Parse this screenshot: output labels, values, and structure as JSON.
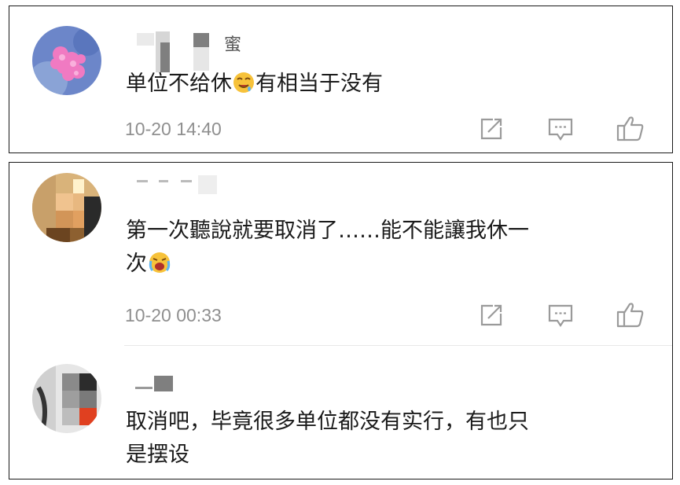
{
  "comments": [
    {
      "username_visible": "蜜",
      "text": "单位不给休",
      "text_after_emoji": "有相当于没有",
      "timestamp": "10-20 14:40",
      "emoji": "drooling-face"
    },
    {
      "text_line1": "第一次聽說就要取消了……能不能讓我休一",
      "text_line2": "次",
      "timestamp": "10-20 00:33",
      "emoji": "crying-face"
    },
    {
      "text_line1": "取消吧，毕竟很多单位都没有实行，有也只",
      "text_line2": "是摆设"
    }
  ],
  "icons": {
    "share": "share-icon",
    "comment": "comment-icon",
    "like": "thumbs-up-icon"
  },
  "colors": {
    "timestamp": "#8f8f8f",
    "text": "#1b1b1b",
    "icon": "#9a9a9a"
  }
}
